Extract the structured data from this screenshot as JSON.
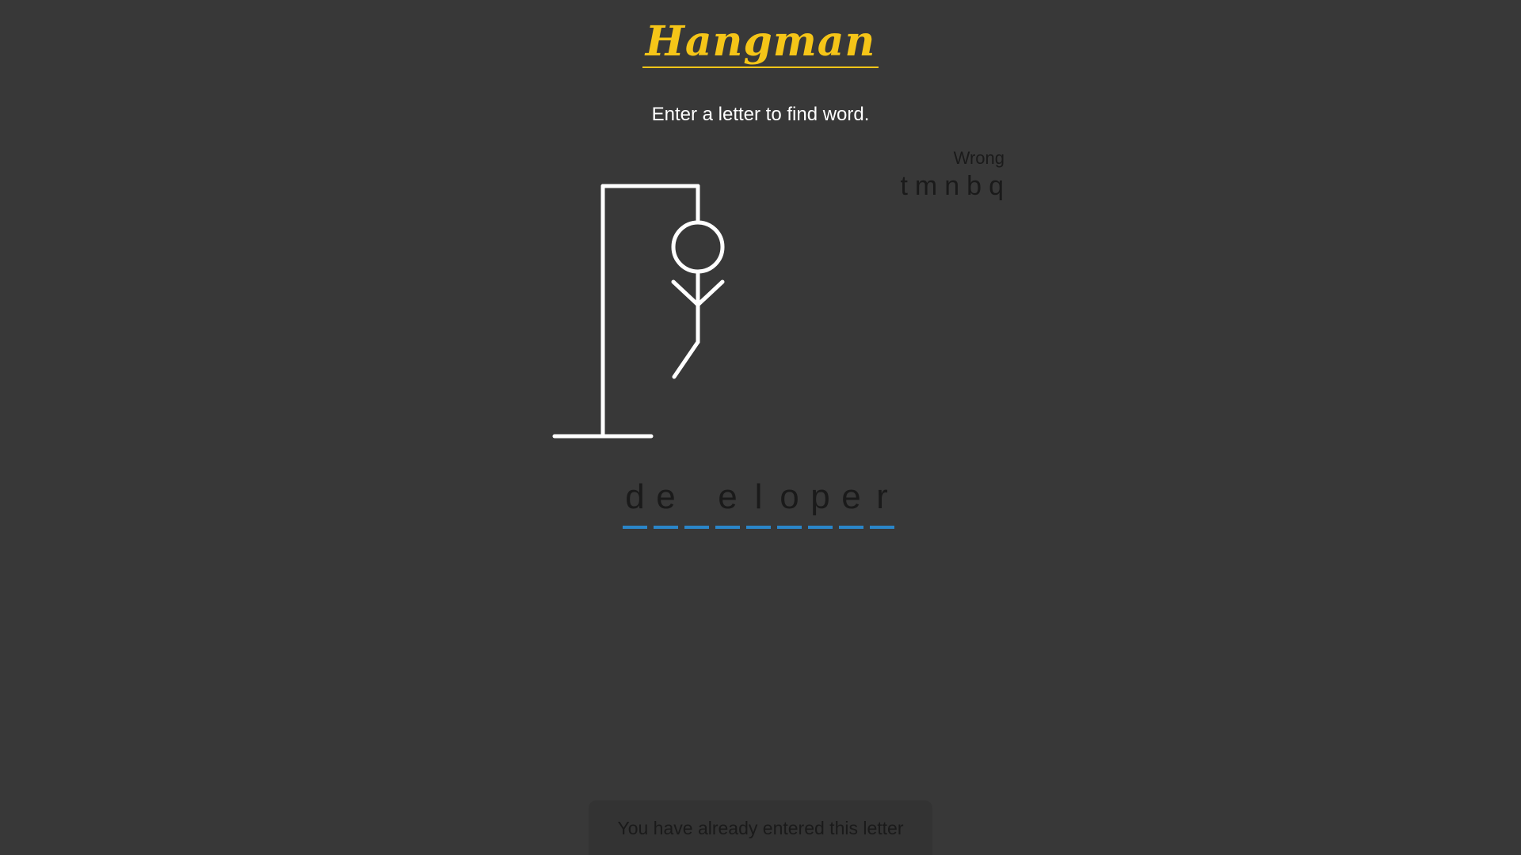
{
  "header": {
    "title": "Hangman",
    "subtitle": "Enter a letter to find word."
  },
  "wrong": {
    "label": "Wrong",
    "letters": [
      "t",
      "m",
      "n",
      "b",
      "q"
    ]
  },
  "word": {
    "slots": [
      "d",
      "e",
      "",
      "e",
      "l",
      "o",
      "p",
      "e",
      "r"
    ]
  },
  "notification": {
    "message": "You have already entered this letter"
  },
  "colors": {
    "background": "#383838",
    "title": "#f5c518",
    "underline": "#2a86c9",
    "figure": "#ffffff"
  }
}
